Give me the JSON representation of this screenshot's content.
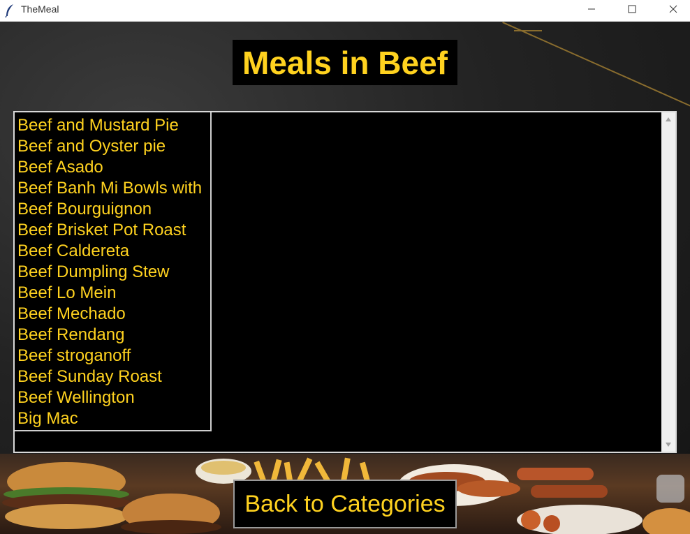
{
  "window": {
    "title": "TheMeal"
  },
  "heading": "Meals in Beef",
  "meals": [
    "Beef and Mustard Pie",
    "Beef and Oyster pie",
    "Beef Asado",
    "Beef Banh Mi Bowls with",
    "Beef Bourguignon",
    "Beef Brisket Pot Roast",
    "Beef Caldereta",
    "Beef Dumpling Stew",
    "Beef Lo Mein",
    "Beef Mechado",
    "Beef Rendang",
    "Beef stroganoff",
    "Beef Sunday Roast",
    "Beef Wellington",
    "Big Mac"
  ],
  "back_button": "Back to Categories",
  "colors": {
    "accent": "#ffd21f",
    "panel": "#000000",
    "titlebar": "#ffffff"
  },
  "icons": {
    "app": "feather-icon",
    "minimize": "minimize-icon",
    "maximize": "maximize-icon",
    "close": "close-icon",
    "scroll_up": "scroll-up-arrow-icon",
    "scroll_down": "scroll-down-arrow-icon"
  }
}
